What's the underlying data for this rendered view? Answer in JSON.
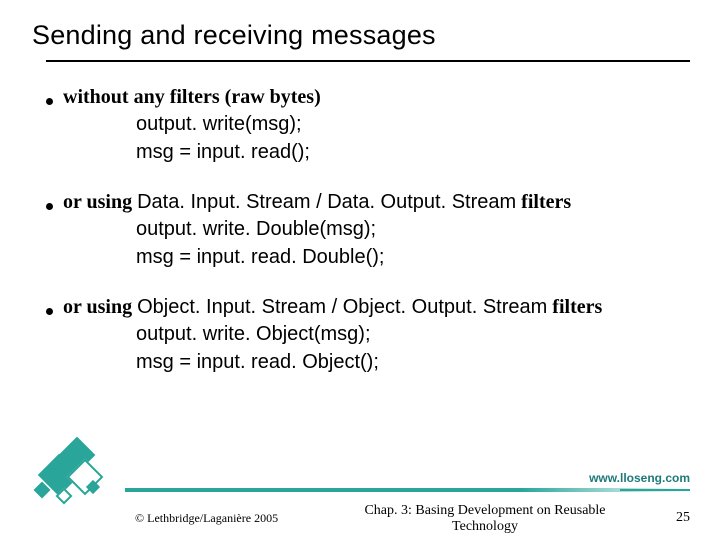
{
  "title": "Sending and receiving messages",
  "bullets": [
    {
      "lead": "without any filters (raw bytes)",
      "code": [
        "output. write(msg);",
        "msg = input. read();"
      ]
    },
    {
      "lead": "or using ",
      "tech": "Data. Input. Stream / Data. Output. Stream",
      "trail": " filters",
      "code": [
        "output. write. Double(msg);",
        "msg = input. read. Double();"
      ]
    },
    {
      "lead": "or using ",
      "tech": "Object. Input. Stream / Object. Output. Stream",
      "trail": " filters",
      "code": [
        "output. write. Object(msg);",
        "msg = input. read. Object();"
      ]
    }
  ],
  "footer": {
    "url": "www.lloseng.com",
    "copyright": "© Lethbridge/Laganière 2005",
    "chapter": "Chap. 3: Basing Development on Reusable Technology",
    "page": "25"
  }
}
